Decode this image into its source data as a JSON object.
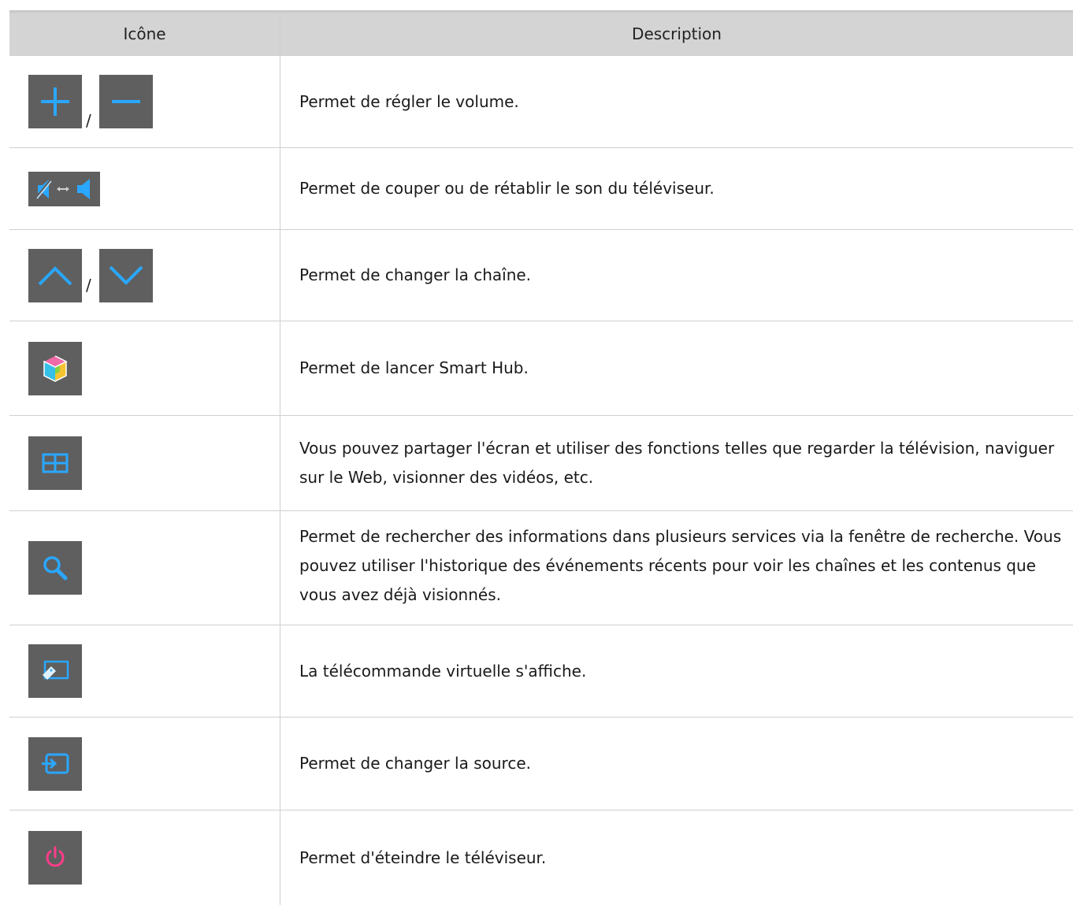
{
  "header": {
    "icon_col": "Icône",
    "desc_col": "Description"
  },
  "rows": [
    {
      "icons": [
        "plus-icon",
        "minus-icon"
      ],
      "separator": "/",
      "description": "Permet de régler le volume."
    },
    {
      "icons": [
        "mute-unmute-icon"
      ],
      "description": "Permet de couper ou de rétablir le son du téléviseur."
    },
    {
      "icons": [
        "chevron-up-icon",
        "chevron-down-icon"
      ],
      "separator": "/",
      "description": "Permet de changer la chaîne."
    },
    {
      "icons": [
        "smart-hub-icon"
      ],
      "description": "Permet de lancer Smart Hub."
    },
    {
      "icons": [
        "multi-screen-icon"
      ],
      "description": "Vous pouvez partager l'écran et utiliser des fonctions telles que regarder la télévision, naviguer sur le Web, visionner des vidéos, etc."
    },
    {
      "icons": [
        "search-icon"
      ],
      "description": "Permet de rechercher des informations dans plusieurs services via la fenêtre de recherche. Vous pouvez utiliser l'historique des événements récents pour voir les chaînes et les contenus que vous avez déjà visionnés."
    },
    {
      "icons": [
        "virtual-remote-icon"
      ],
      "description": "La télécommande virtuelle s'affiche."
    },
    {
      "icons": [
        "source-icon"
      ],
      "description": "Permet de changer la source."
    },
    {
      "icons": [
        "power-icon"
      ],
      "description": "Permet d'éteindre le téléviseur."
    }
  ],
  "colors": {
    "button_bg": "#5f5f5f",
    "glyph_blue": "#2aa7ff",
    "power_pink": "#ff3d8a",
    "header_bg": "#d4d4d4"
  }
}
